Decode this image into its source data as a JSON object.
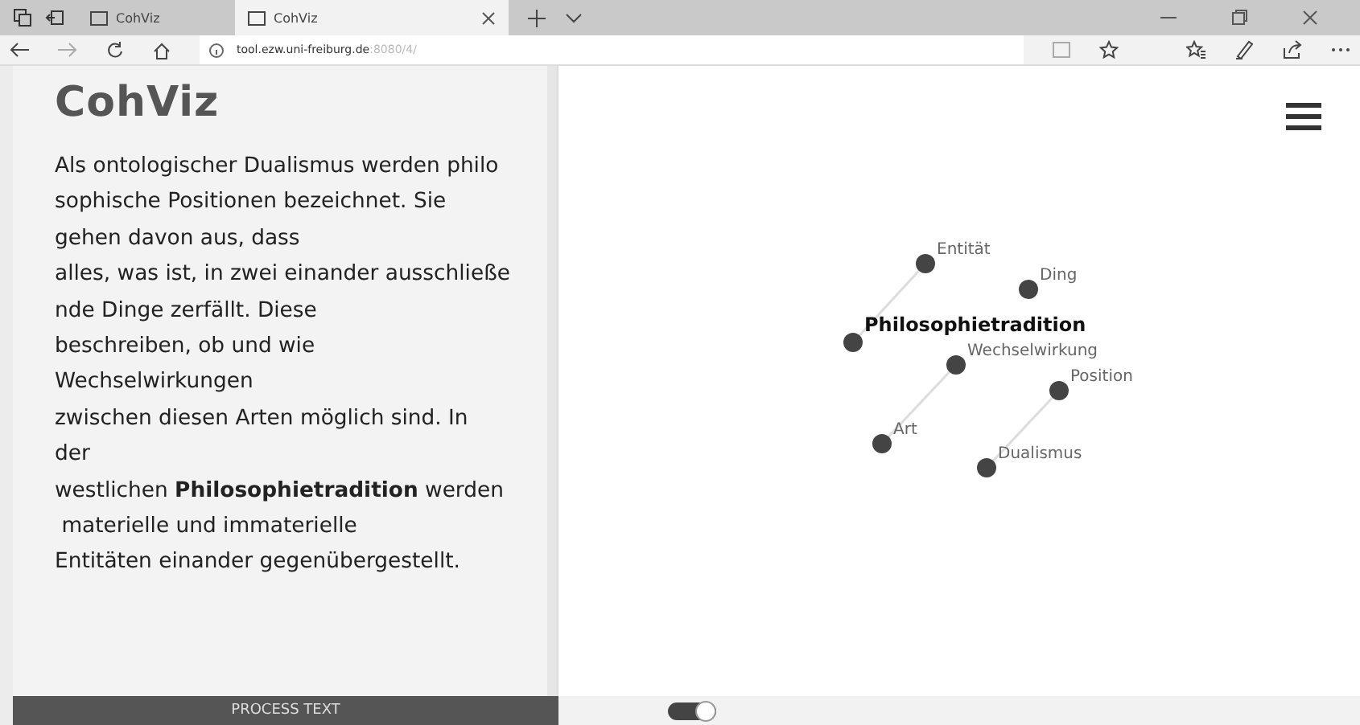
{
  "browser": {
    "tabs": [
      {
        "title": "CohViz",
        "selected": false
      },
      {
        "title": "CohViz",
        "selected": true
      }
    ],
    "address": {
      "host": "tool.ezw.uni-freiburg.de",
      "path": ":8080/4/"
    }
  },
  "sidebar": {
    "title": "CohViz",
    "text": "Als ontologischer Dualismus werden philo\nsophische Positionen bezeichnet. Sie\ngehen davon aus, dass\nalles, was ist, in zwei einander ausschließe\nnde Dinge zerfällt. Diese\nbeschreiben, ob und wie\nWechselwirkungen\nzwischen diesen Arten möglich sind. In\nder\nwestlichen **Philosophietradition** werden\n materielle und immaterielle\nEntitäten einander gegenübergestellt.",
    "button": "PROCESS TEXT"
  },
  "graph": {
    "nodes": [
      {
        "label": "Entität",
        "central": false
      },
      {
        "label": "Ding",
        "central": false
      },
      {
        "label": "Philosophietradition",
        "central": true
      },
      {
        "label": "Wechselwirkung",
        "central": false
      },
      {
        "label": "Position",
        "central": false
      },
      {
        "label": "Art",
        "central": false
      },
      {
        "label": "Dualismus",
        "central": false
      }
    ]
  },
  "toggle": {
    "on": true
  }
}
